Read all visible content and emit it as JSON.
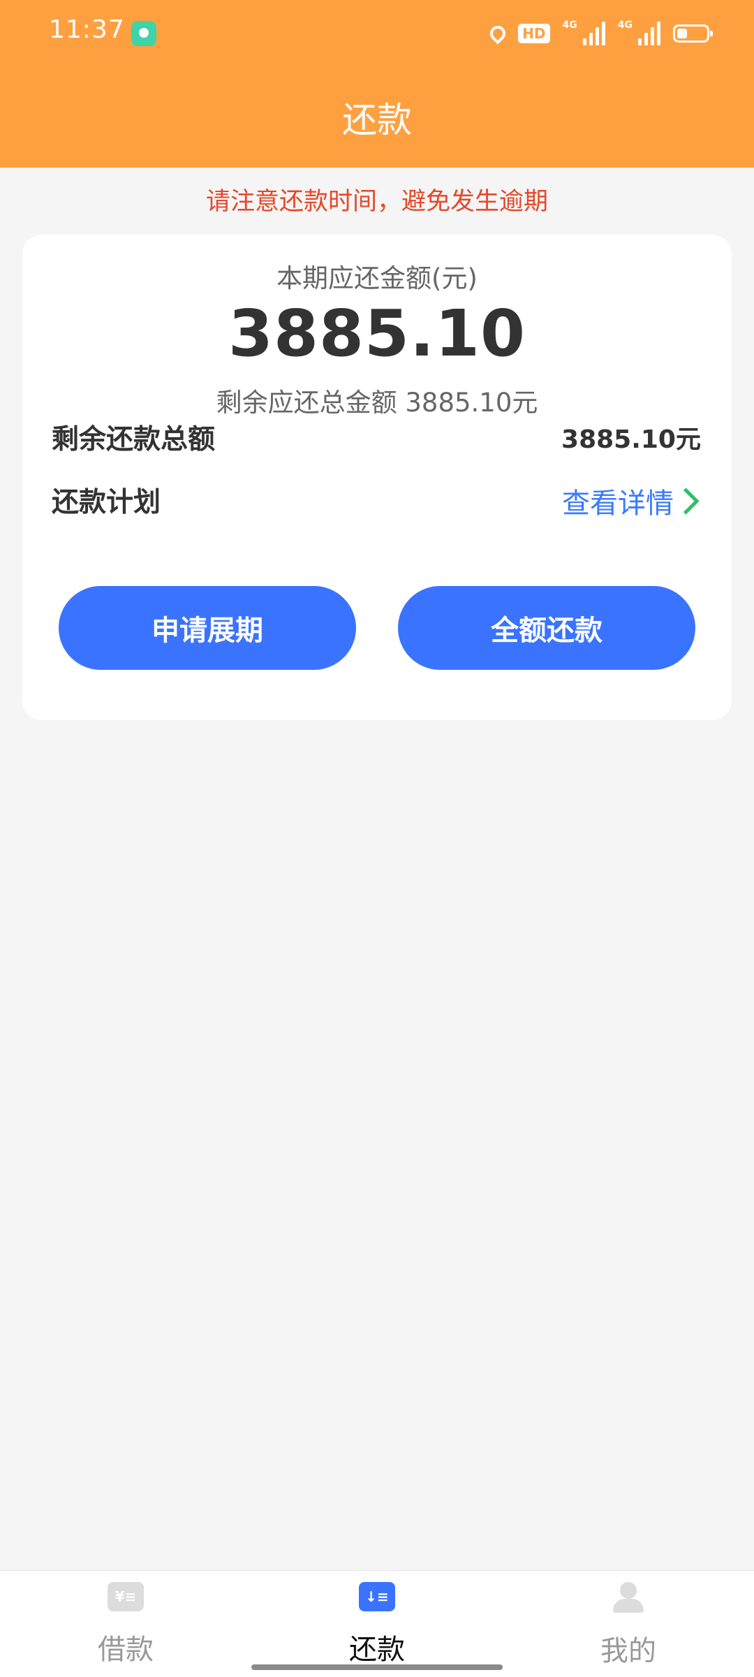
{
  "status_bar": {
    "time": "11:37",
    "hd_label": "HD",
    "net_label_1": "4G",
    "net_label_2": "4G"
  },
  "header": {
    "title": "还款"
  },
  "notice": "请注意还款时间，避免发生逾期",
  "card": {
    "amount_label": "本期应还金额(元)",
    "amount_value": "3885.10",
    "remaining_line": "剩余应还总金额 3885.10元",
    "rows": {
      "total_remaining": {
        "label": "剩余还款总额",
        "value": "3885.10元"
      },
      "plan": {
        "label": "还款计划",
        "link": "查看详情"
      }
    },
    "buttons": {
      "extend": "申请展期",
      "full_repay": "全额还款"
    }
  },
  "bottom_nav": {
    "items": [
      {
        "label": "借款",
        "icon": "yen-list-icon",
        "active": false
      },
      {
        "label": "还款",
        "icon": "repay-list-icon",
        "active": true
      },
      {
        "label": "我的",
        "icon": "profile-icon",
        "active": false
      }
    ]
  },
  "colors": {
    "header": "#ffa040",
    "notice": "#e5482a",
    "primary_button": "#3a73ff",
    "link": "#3a7afe",
    "chevron": "#2fbf6a",
    "background": "#f5f5f5"
  }
}
